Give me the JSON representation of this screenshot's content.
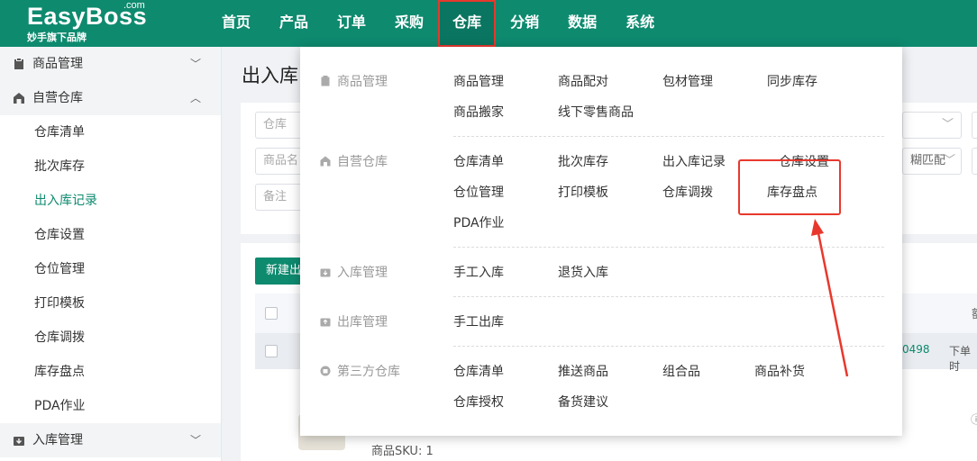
{
  "brand": {
    "name": "EasyBoss",
    "com": ".com",
    "tagline": "妙手旗下品牌"
  },
  "nav": [
    "首页",
    "产品",
    "订单",
    "采购",
    "仓库",
    "分销",
    "数据",
    "系统"
  ],
  "nav_active": "仓库",
  "sidebar": {
    "groups": [
      {
        "label": "商品管理",
        "chev": "﹀",
        "icon": "clipboard-icon"
      },
      {
        "label": "自营仓库",
        "chev": "︿",
        "icon": "warehouse-icon"
      },
      {
        "label": "入库管理",
        "chev": "﹀",
        "icon": "inbound-icon"
      }
    ],
    "items": [
      "仓库清单",
      "批次库存",
      "出入库记录",
      "仓库设置",
      "仓位管理",
      "打印模板",
      "仓库调拨",
      "库存盘点",
      "PDA作业"
    ],
    "active_item": "出入库记录"
  },
  "main": {
    "title": "出入库",
    "filters": {
      "warehouse": "仓库",
      "product_name": "商品名",
      "remark": "备注",
      "fuzzy": "糊匹配"
    },
    "new_button": "新建出",
    "row": {
      "code": "0498",
      "status": "下单时"
    },
    "sku_label": "商品SKU: 1",
    "header_partial": "额"
  },
  "dropdown": {
    "sections": [
      {
        "category": "商品管理",
        "icon": "clipboard-icon",
        "links": [
          [
            "商品管理",
            "商品配对",
            "包材管理",
            "同步库存"
          ],
          [
            "商品搬家",
            "线下零售商品"
          ]
        ]
      },
      {
        "category": "自营仓库",
        "icon": "warehouse-icon",
        "links": [
          [
            "仓库清单",
            "批次库存",
            "出入库记录",
            "仓库设置"
          ],
          [
            "仓位管理",
            "打印模板",
            "仓库调拨",
            "库存盘点"
          ],
          [
            "PDA作业"
          ]
        ]
      },
      {
        "category": "入库管理",
        "icon": "inbound-icon",
        "links": [
          [
            "手工入库",
            "退货入库"
          ]
        ]
      },
      {
        "category": "出库管理",
        "icon": "outbound-icon",
        "links": [
          [
            "手工出库"
          ]
        ]
      },
      {
        "category": "第三方仓库",
        "icon": "third-party-icon",
        "links": [
          [
            "仓库清单",
            "推送商品",
            "组合品",
            "商品补货"
          ],
          [
            "仓库授权",
            "备货建议"
          ]
        ]
      }
    ],
    "highlighted_link": "库存盘点"
  },
  "annotation_color": "#e8382d",
  "accent_color": "#0e8a6f"
}
